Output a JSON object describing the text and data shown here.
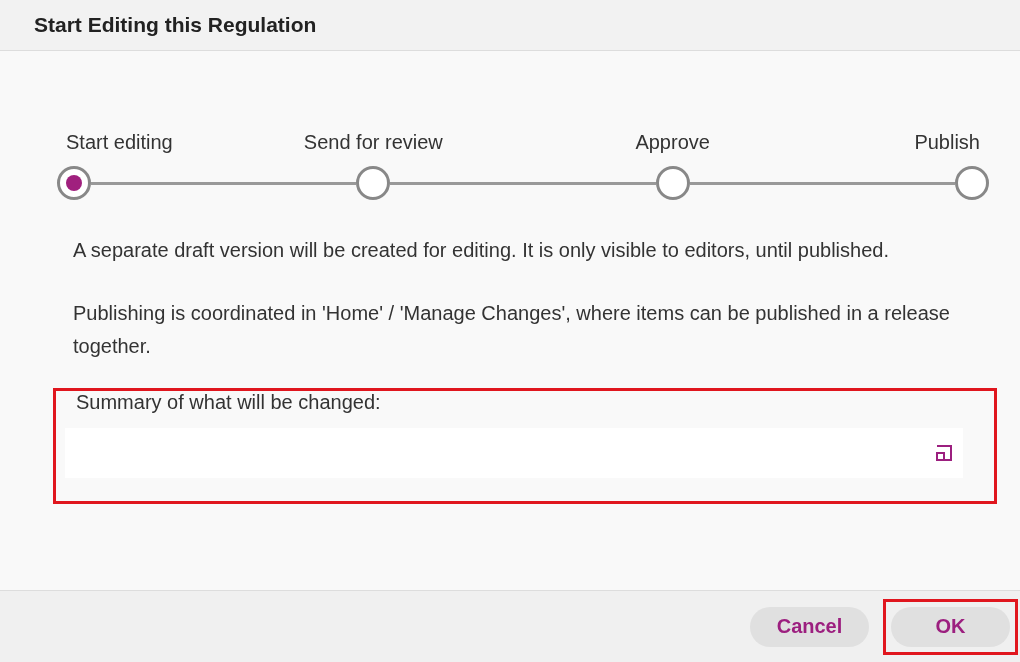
{
  "dialog": {
    "title": "Start Editing this Regulation"
  },
  "steps": [
    {
      "label": "Start editing",
      "selected": true
    },
    {
      "label": "Send for review",
      "selected": false
    },
    {
      "label": "Approve",
      "selected": false
    },
    {
      "label": "Publish",
      "selected": false
    }
  ],
  "paragraphs": [
    "A separate draft version will be created for editing. It is only visible to editors, until published.",
    "Publishing is coordinated in 'Home' / 'Manage Changes', where items can be published in a release together."
  ],
  "summary": {
    "label": "Summary of what will be changed:",
    "highlighted": true
  },
  "buttons": [
    {
      "label": "Cancel",
      "highlighted": false
    },
    {
      "label": "OK",
      "highlighted": true
    }
  ]
}
